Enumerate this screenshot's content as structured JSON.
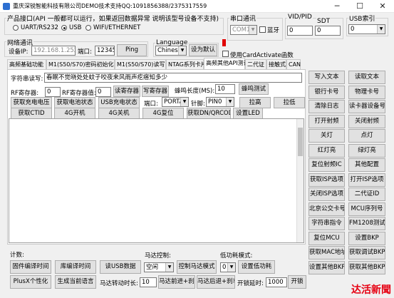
{
  "window": {
    "title": "重庆深锐智能科技有限公司DEMO技术支持QQ:1091856388/2375317559",
    "minimize": "─",
    "maximize": "☐",
    "close": "✕"
  },
  "product_interface": {
    "group_label": "产品接口(API 一般都可以运行，如果返回数据异常 说明该型号设备不支持)",
    "options": [
      "UART/RS232",
      "USB",
      "WIFI/ETHERNET"
    ],
    "selected": "USB"
  },
  "serial": {
    "group_label": "串口通讯",
    "port_value": "COM1",
    "bluetooth_label": "蓝牙"
  },
  "vid_pid": {
    "vid_label": "VID/PID",
    "vid_value": "0",
    "sdt_label": "SDT",
    "pid_value": "0"
  },
  "usb_index": {
    "group_label": "USB索引",
    "value": "0"
  },
  "network": {
    "group_label": "网络通讯",
    "ip_label": "设备IP:",
    "ip_value": "192.168.1.252",
    "port_label": "端口:",
    "port_value": "12345",
    "ping_button": "Ping"
  },
  "language": {
    "label": "Language",
    "value": "Chinese",
    "set_default_button": "设为默认",
    "card_activate_label": "使用CardActivate函数"
  },
  "tabs": [
    "高频基础功能",
    "M1(S50/S70)密码初始化",
    "M1(S50/S70)读写",
    "NTAG系列卡片",
    "高频其他API测试",
    "二代证",
    "接触式",
    "CAN"
  ],
  "active_tab": "高频其他API测试",
  "panel": {
    "string_label": "字符串读写:",
    "string_value": "春眠不觉晓处处蚊子咬夜来风雨声疙瘩知多少",
    "rf_reg_label": "RF寄存器:",
    "rf_reg_value": "0",
    "rf_reg_val_label": "RF寄存器值:",
    "rf_reg_val_value": "0",
    "read_reg_button": "读寄存器",
    "write_reg_button": "写寄存器",
    "beep_label": "蜂鸣长度(MS):",
    "beep_value": "10",
    "beep_test_button": "蜂鸣测试",
    "get_charge_voltage_button": "获取充电电压",
    "get_battery_state_button": "获取电池状态",
    "usb_charge_state_button": "USB充电状态",
    "port_label": "端口:",
    "port_value": "PORTA",
    "pin_label": "针脚:",
    "pin_value": "PIN0",
    "pull_high_button": "拉高",
    "pull_low_button": "拉低",
    "get_ctid_button": "获取CTID",
    "g4_on_button": "4G开机",
    "g4_off_button": "4G关机",
    "g4_reset_button": "4G复位",
    "get_dn_qrcode_button": "获取DN/QRCODE",
    "set_led_button": "设置LED"
  },
  "right_buttons": [
    [
      "写入文本",
      "读取文本"
    ],
    [
      "银行卡号",
      "物理卡号"
    ],
    [
      "清除日志",
      "读卡器设备号"
    ],
    [
      "打开射频",
      "关闭射频"
    ],
    [
      "关灯",
      "点灯"
    ],
    [
      "红灯亮",
      "绿灯亮"
    ],
    [
      "复位射频IC",
      "其他配置"
    ],
    [
      "获取ISP选项",
      "打开ISP选项"
    ],
    [
      "关闭ISP选项",
      "二代证ID"
    ],
    [
      "北京公交卡号",
      "MCU序列号"
    ],
    [
      "字符串指令",
      "FM1208测试"
    ],
    [
      "复位MCU",
      "设置BKP"
    ],
    [
      "获取MAC地址",
      "获取调试BKP"
    ],
    [
      "设置其他BKP",
      "获取其他BKP"
    ]
  ],
  "bottom": {
    "count_label": "计数:",
    "firmware_time_button": "固件编译时间",
    "lib_time_button": "库编译时间",
    "read_usb_data_button": "读USB数据",
    "motor_control_label": "马达控制:",
    "motor_mode_value": "空闲",
    "control_motor_mode_button": "控制马达模式",
    "low_power_label": "低功耗模式:",
    "low_power_value": "0",
    "set_low_power_button": "设置低功耗",
    "plusx_button": "PlusX个性化",
    "gen_lang_button": "生成当前语言",
    "motor_time_label": "马达转动时长:",
    "motor_time_value": "10",
    "motor_forward_button": "马达前进+刹车",
    "motor_backward_button": "马达后退+刹车",
    "switch_delay_label": "开锁延时:",
    "switch_delay_value": "1000",
    "open_lock_button": "开锁"
  },
  "watermark": "达活新聞",
  "colors": {
    "accent": "#2c6fd1",
    "indicator": "#e00000",
    "watermark": "#e60012"
  }
}
